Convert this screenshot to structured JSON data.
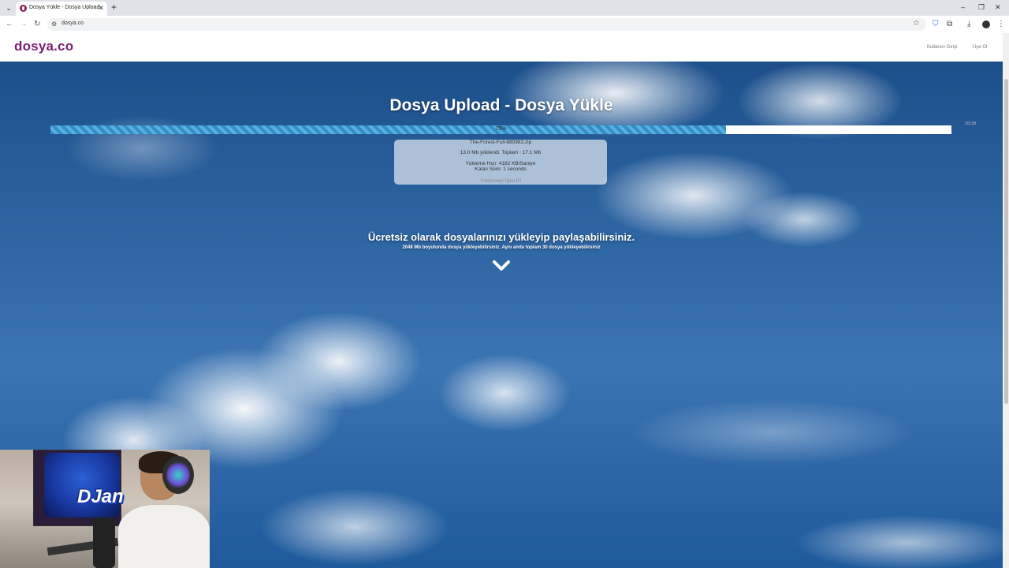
{
  "browser": {
    "tab_title": "Dosya Yükle - Dosya Upload",
    "tab_close": "✕",
    "new_tab": "+",
    "url": "dosya.co",
    "win_min": "–",
    "win_restore": "❐",
    "win_close": "✕"
  },
  "site": {
    "logo": "dosya.co",
    "login_label": "Kullanıcı Girişi",
    "register_label": "Üye Ol"
  },
  "hero": {
    "title": "Dosya Upload - Dosya Yükle",
    "progress": {
      "percent": 75,
      "label": "75%",
      "small_text": "2013B"
    },
    "upload": {
      "filename": "The-Forest-Full-680983.zip",
      "size_line": "13.0 Mb yüklendi. Toplam : 17.1 Mb",
      "speed_line": "Yükleme Hızı: 4182 KB/Saniye",
      "remaining_line": "Kalan Süre: 1 seconds",
      "cancel_label": "Yüklemeyi İptal Et"
    },
    "tagline": "Ücretsiz olarak dosyalarınızı yükleyip paylaşabilirsiniz.",
    "subline": "2048 Mb boyutunda dosya yükleyebilirsiniz. Aynı anda toplam 30 dosya yükleyebilirsiniz"
  },
  "webcam": {
    "poster_text": "DJan"
  },
  "colors": {
    "brand": "#7a1e73",
    "progress": "#2f8fc6"
  }
}
